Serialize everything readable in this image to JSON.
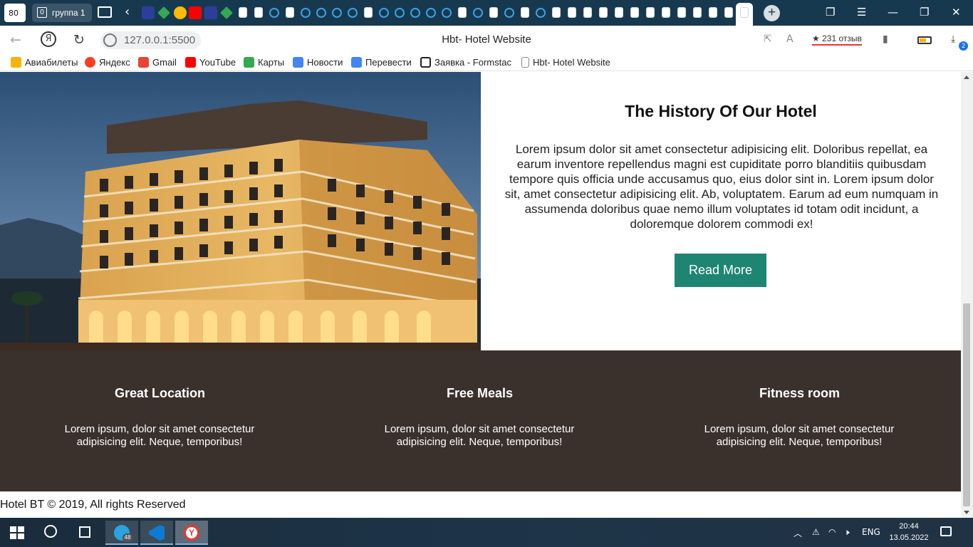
{
  "browser": {
    "tab_counter": "80",
    "tab_group": {
      "count": "0",
      "label": "группа 1"
    },
    "window_title": "Hbt- Hotel Website",
    "url": "127.0.0.1:5500",
    "reviews": "231 отзыв",
    "downloads_badge": "2",
    "bookmarks": [
      {
        "label": "Авиабилеты",
        "icon": "plane-icon",
        "color": "#f4b400"
      },
      {
        "label": "Яндекс",
        "icon": "yandex-icon",
        "color": "#fc3f1d"
      },
      {
        "label": "Gmail",
        "icon": "gmail-icon",
        "color": "#ea4335"
      },
      {
        "label": "YouTube",
        "icon": "youtube-icon",
        "color": "#ff0000"
      },
      {
        "label": "Карты",
        "icon": "maps-icon",
        "color": "#34a853"
      },
      {
        "label": "Новости",
        "icon": "news-icon",
        "color": "#4285f4"
      },
      {
        "label": "Перевести",
        "icon": "translate-icon",
        "color": "#4285f4"
      },
      {
        "label": "Заявка - Formstac",
        "icon": "formstack-icon",
        "color": "#222222"
      },
      {
        "label": "Hbt- Hotel Website",
        "icon": "page-icon",
        "color": "#888888"
      }
    ]
  },
  "page": {
    "history": {
      "title": "The History Of Our Hotel",
      "body": "Lorem ipsum dolor sit amet consectetur adipisicing elit. Doloribus repellat, ea earum inventore repellendus magni est cupiditate porro blanditiis quibusdam tempore quis officia unde accusamus quo, eius dolor sint in. Lorem ipsum dolor sit, amet consectetur adipisicing elit. Ab, voluptatem. Earum ad eum numquam in assumenda doloribus quae nemo illum voluptates id totam odit incidunt, a doloremque dolorem commodi ex!",
      "button": "Read More",
      "button_color": "#1f8573"
    },
    "features_bg": "#3a302c",
    "features": [
      {
        "title": "Great Location",
        "text": "Lorem ipsum, dolor sit amet consectetur adipisicing elit. Neque, temporibus!"
      },
      {
        "title": "Free Meals",
        "text": "Lorem ipsum, dolor sit amet consectetur adipisicing elit. Neque, temporibus!"
      },
      {
        "title": "Fitness room",
        "text": "Lorem ipsum, dolor sit amet consectetur adipisicing elit. Neque, temporibus!"
      }
    ],
    "footer": "Hotel BT © 2019, All rights Reserved"
  },
  "taskbar": {
    "telegram_badge": "48",
    "language": "ENG",
    "time": "20:44",
    "date": "13.05.2022"
  }
}
